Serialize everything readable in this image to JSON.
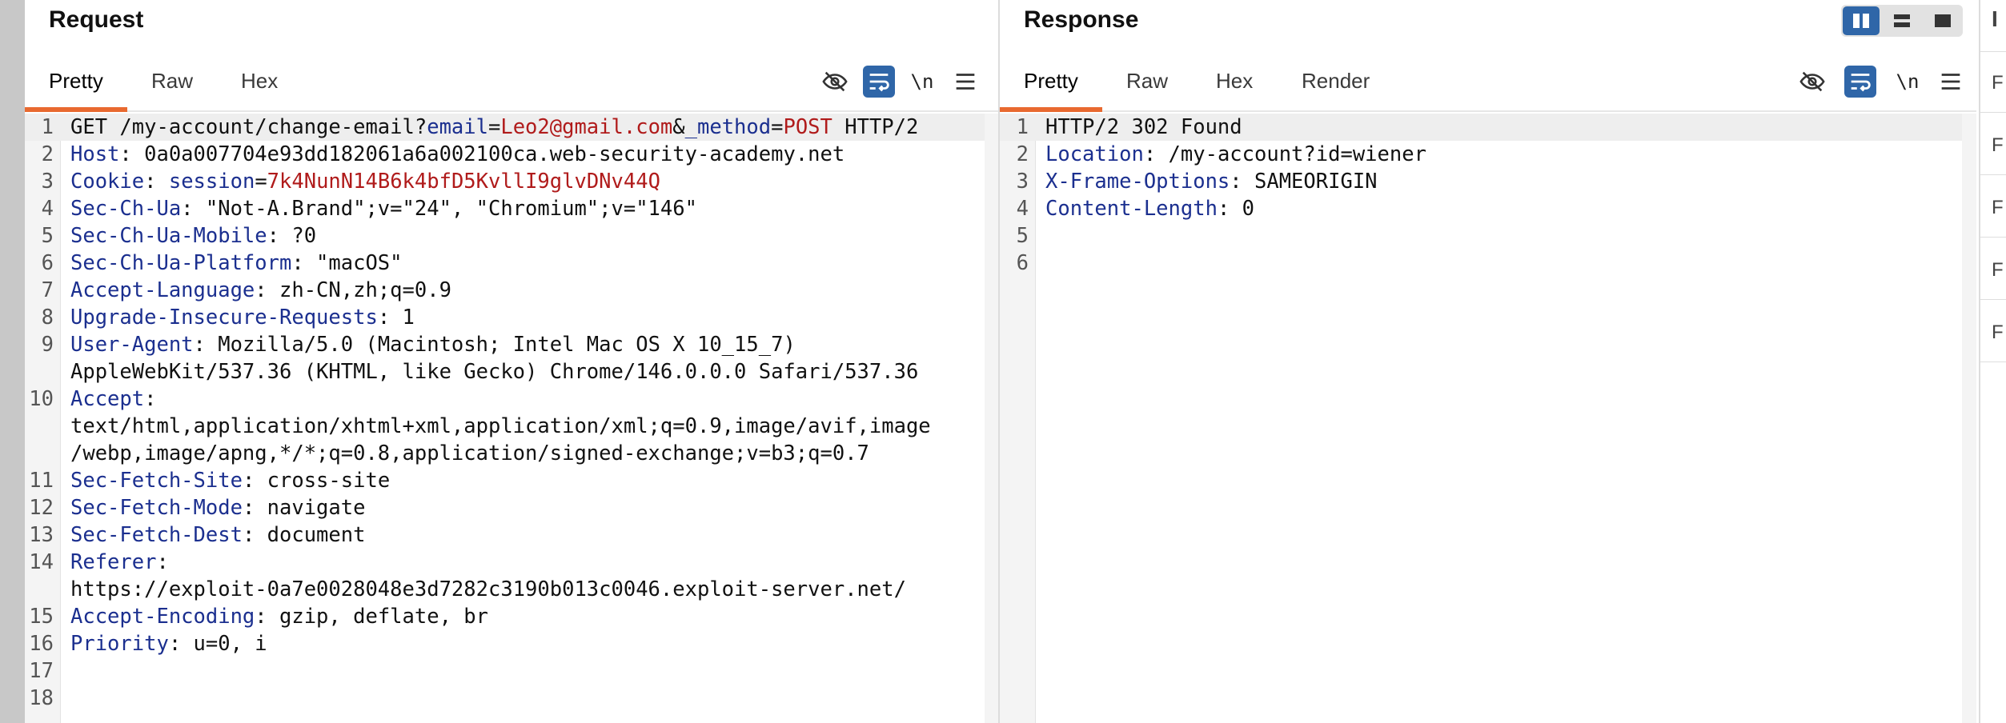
{
  "request": {
    "title": "Request",
    "tabs": [
      "Pretty",
      "Raw",
      "Hex"
    ],
    "active_tab": "Pretty",
    "newline_label": "\\n",
    "lines": [
      {
        "n": "1",
        "parts": [
          [
            "t",
            "GET /my-account/change-email?"
          ],
          [
            "pn",
            "email"
          ],
          [
            "t",
            "="
          ],
          [
            "pv",
            "Leo2@gmail.com"
          ],
          [
            "t",
            "&"
          ],
          [
            "pn",
            "_method"
          ],
          [
            "t",
            "="
          ],
          [
            "pv",
            "POST"
          ],
          [
            "t",
            " HTTP/2"
          ]
        ]
      },
      {
        "n": "2",
        "parts": [
          [
            "hn",
            "Host"
          ],
          [
            "t",
            ": 0a0a007704e93dd182061a6a002100ca.web-security-academy.net"
          ]
        ]
      },
      {
        "n": "3",
        "parts": [
          [
            "hn",
            "Cookie"
          ],
          [
            "t",
            ": "
          ],
          [
            "pn",
            "session"
          ],
          [
            "t",
            "="
          ],
          [
            "pv",
            "7k4NunN14B6k4bfD5KvllI9glvDNv44Q"
          ]
        ]
      },
      {
        "n": "4",
        "parts": [
          [
            "hn",
            "Sec-Ch-Ua"
          ],
          [
            "t",
            ": \"Not-A.Brand\";v=\"24\", \"Chromium\";v=\"146\""
          ]
        ]
      },
      {
        "n": "5",
        "parts": [
          [
            "hn",
            "Sec-Ch-Ua-Mobile"
          ],
          [
            "t",
            ": ?0"
          ]
        ]
      },
      {
        "n": "6",
        "parts": [
          [
            "hn",
            "Sec-Ch-Ua-Platform"
          ],
          [
            "t",
            ": \"macOS\""
          ]
        ]
      },
      {
        "n": "7",
        "parts": [
          [
            "hn",
            "Accept-Language"
          ],
          [
            "t",
            ": zh-CN,zh;q=0.9"
          ]
        ]
      },
      {
        "n": "8",
        "parts": [
          [
            "hn",
            "Upgrade-Insecure-Requests"
          ],
          [
            "t",
            ": 1"
          ]
        ]
      },
      {
        "n": "9",
        "parts": [
          [
            "hn",
            "User-Agent"
          ],
          [
            "t",
            ": Mozilla/5.0 (Macintosh; Intel Mac OS X 10_15_7)"
          ]
        ]
      },
      {
        "n": "",
        "parts": [
          [
            "t",
            "AppleWebKit/537.36 (KHTML, like Gecko) Chrome/146.0.0.0 Safari/537.36"
          ]
        ]
      },
      {
        "n": "10",
        "parts": [
          [
            "hn",
            "Accept"
          ],
          [
            "t",
            ":"
          ]
        ]
      },
      {
        "n": "",
        "parts": [
          [
            "t",
            "text/html,application/xhtml+xml,application/xml;q=0.9,image/avif,image"
          ]
        ]
      },
      {
        "n": "",
        "parts": [
          [
            "t",
            "/webp,image/apng,*/*;q=0.8,application/signed-exchange;v=b3;q=0.7"
          ]
        ]
      },
      {
        "n": "11",
        "parts": [
          [
            "hn",
            "Sec-Fetch-Site"
          ],
          [
            "t",
            ": cross-site"
          ]
        ]
      },
      {
        "n": "12",
        "parts": [
          [
            "hn",
            "Sec-Fetch-Mode"
          ],
          [
            "t",
            ": navigate"
          ]
        ]
      },
      {
        "n": "13",
        "parts": [
          [
            "hn",
            "Sec-Fetch-Dest"
          ],
          [
            "t",
            ": document"
          ]
        ]
      },
      {
        "n": "14",
        "parts": [
          [
            "hn",
            "Referer"
          ],
          [
            "t",
            ":"
          ]
        ]
      },
      {
        "n": "",
        "parts": [
          [
            "t",
            "https://exploit-0a7e0028048e3d7282c3190b013c0046.exploit-server.net/"
          ]
        ]
      },
      {
        "n": "15",
        "parts": [
          [
            "hn",
            "Accept-Encoding"
          ],
          [
            "t",
            ": gzip, deflate, br"
          ]
        ]
      },
      {
        "n": "16",
        "parts": [
          [
            "hn",
            "Priority"
          ],
          [
            "t",
            ": u=0, i"
          ]
        ]
      },
      {
        "n": "17",
        "parts": []
      },
      {
        "n": "18",
        "parts": []
      }
    ]
  },
  "response": {
    "title": "Response",
    "tabs": [
      "Pretty",
      "Raw",
      "Hex",
      "Render"
    ],
    "active_tab": "Pretty",
    "newline_label": "\\n",
    "lines": [
      {
        "n": "1",
        "parts": [
          [
            "t",
            "HTTP/2 302 Found"
          ]
        ]
      },
      {
        "n": "2",
        "parts": [
          [
            "hn",
            "Location"
          ],
          [
            "t",
            ": /my-account?id=wiener"
          ]
        ]
      },
      {
        "n": "3",
        "parts": [
          [
            "hn",
            "X-Frame-Options"
          ],
          [
            "t",
            ": SAMEORIGIN"
          ]
        ]
      },
      {
        "n": "4",
        "parts": [
          [
            "hn",
            "Content-Length"
          ],
          [
            "t",
            ": 0"
          ]
        ]
      },
      {
        "n": "5",
        "parts": []
      },
      {
        "n": "6",
        "parts": []
      }
    ]
  },
  "right_edge": {
    "header_letter": "I",
    "items": [
      "F",
      "F",
      "F",
      "F",
      "F"
    ]
  },
  "colors": {
    "accent_tab_underline": "#e8692f",
    "active_toggle": "#2f66a8",
    "header_name": "#1b2f8f",
    "param_value": "#b01b1b"
  },
  "icons": [
    "hide-icon",
    "wrap-lines-icon",
    "newline-icon",
    "menu-icon",
    "split-vertical-icon",
    "split-horizontal-icon",
    "single-pane-icon"
  ]
}
